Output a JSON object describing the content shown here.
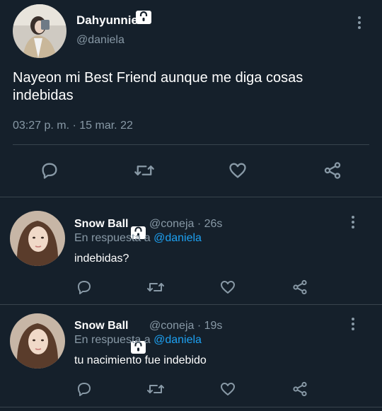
{
  "main_tweet": {
    "display_name": "Dahyunnie",
    "handle": "@daniela",
    "text": "Nayeon mi Best Friend aunque me diga cosas indebidas",
    "timestamp": "03:27 p. m. · 15 mar. 22",
    "avatar": "avatar-photo",
    "lock": "lock-icon"
  },
  "actions": [
    "reply-icon",
    "retweet-icon",
    "like-icon",
    "share-icon"
  ],
  "replies": [
    {
      "display_name": "Snow Ball",
      "handle": "@coneja",
      "time": "· 26s",
      "reply_prefix": "En respuesta a",
      "reply_to": "@daniela",
      "text": "indebidas?"
    },
    {
      "display_name": "Snow Ball",
      "handle": "@coneja",
      "time": "· 19s",
      "reply_prefix": "En respuesta a",
      "reply_to": "@daniela",
      "text": "tu nacimiento fue indebido"
    }
  ],
  "colors": {
    "background": "#15202b",
    "muted": "#8899a6",
    "link": "#1da1f2",
    "divider": "#38444d"
  }
}
